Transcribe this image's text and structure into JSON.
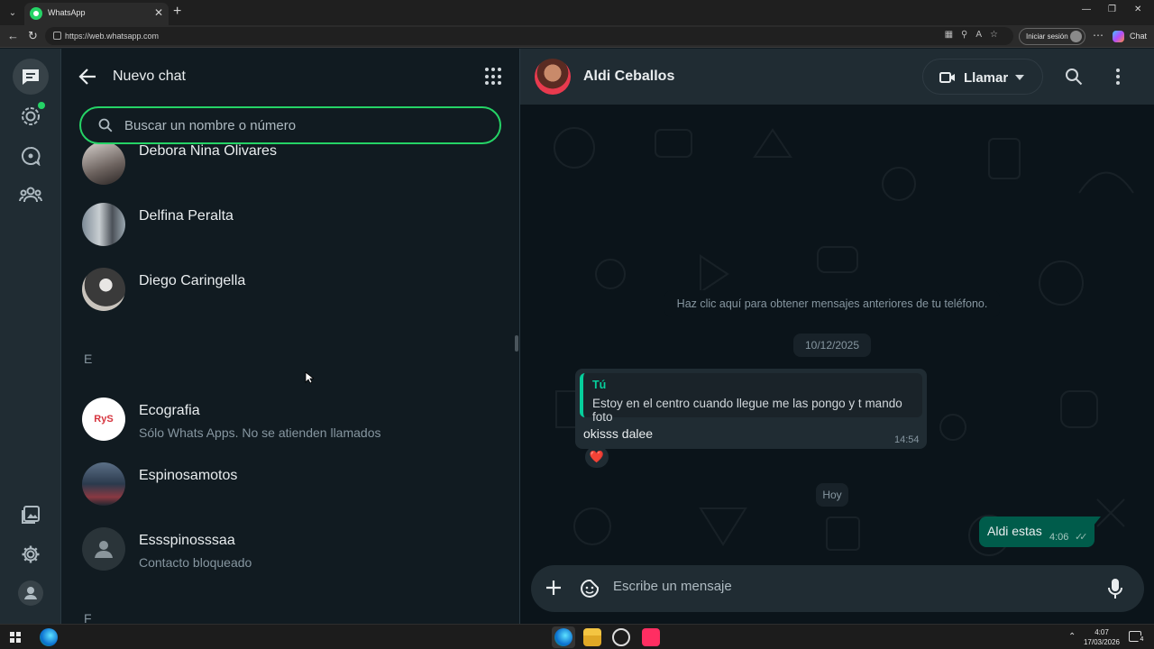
{
  "browser": {
    "tab_title": "WhatsApp",
    "url": "https://web.whatsapp.com",
    "signin_label": "Iniciar sesión",
    "copilot_label": "Chat"
  },
  "left_panel": {
    "title": "Nuevo chat",
    "search_placeholder": "Buscar un nombre o número",
    "contacts": [
      {
        "name": "Debora Nina Olivares",
        "subtitle": ""
      },
      {
        "name": "Delfina Peralta",
        "subtitle": ""
      },
      {
        "name": "Diego Caringella",
        "subtitle": ""
      },
      {
        "name": "Ecografia",
        "subtitle": "Sólo Whats Apps. No se atienden llamados"
      },
      {
        "name": "Espinosamotos",
        "subtitle": ""
      },
      {
        "name": "Essspinosssaa",
        "subtitle": "Contacto bloqueado"
      }
    ],
    "section_letters": [
      "E",
      "F"
    ],
    "ecografia_logo_text": "RyS"
  },
  "chat": {
    "contact_name": "Aldi Ceballos",
    "call_label": "Llamar",
    "system_message": "Haz clic aquí para obtener mensajes anteriores de tu teléfono.",
    "date_1": "10/12/2025",
    "quoted_author": "Tú",
    "quoted_text": "Estoy en el centro cuando llegue me las pongo y t mando foto",
    "incoming_text": "okisss dalee",
    "incoming_time": "14:54",
    "reaction": "❤️",
    "date_2": "Hoy",
    "outgoing_text": "Aldi estas",
    "outgoing_time": "4:06",
    "composer_placeholder": "Escribe un mensaje"
  },
  "taskbar": {
    "time": "4:07",
    "date": "17/03/2026",
    "notification_count": "4"
  },
  "colors": {
    "accent_green": "#25d366",
    "outgoing_bubble": "#005c4b",
    "panel_bg": "#111b21",
    "header_bg": "#202c33"
  }
}
